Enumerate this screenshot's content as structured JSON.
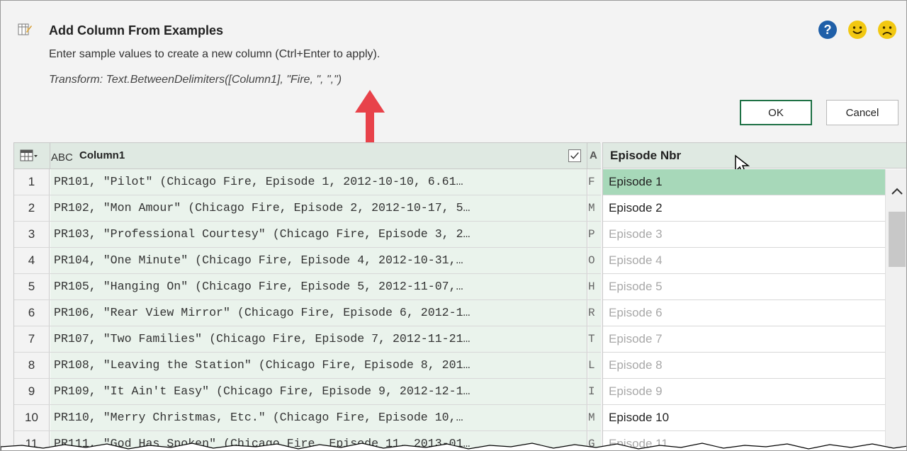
{
  "dialog": {
    "title": "Add Column From Examples",
    "subtitle": "Enter sample values to create a new column (Ctrl+Enter to apply).",
    "transform": "Transform: Text.BetweenDelimiters([Column1], \"Fire, \", \",\")",
    "ok_label": "OK",
    "cancel_label": "Cancel",
    "icons": [
      "help-icon",
      "smile-feedback-icon",
      "frown-feedback-icon"
    ]
  },
  "grid": {
    "column_type": "ABC",
    "column_header": "Column1",
    "column2_header_truncated": "A",
    "rows": [
      {
        "n": "1",
        "text": "PR101, \"Pilot\" (Chicago Fire, Episode 1, 2012-10-10, 6.61…",
        "next": "F"
      },
      {
        "n": "2",
        "text": "PR102, \"Mon Amour\" (Chicago Fire, Episode 2, 2012-10-17, 5…",
        "next": "M"
      },
      {
        "n": "3",
        "text": "PR103, \"Professional Courtesy\" (Chicago Fire, Episode 3, 2…",
        "next": "P"
      },
      {
        "n": "4",
        "text": "PR104, \"One Minute\" (Chicago Fire, Episode 4, 2012-10-31,…",
        "next": "O"
      },
      {
        "n": "5",
        "text": "PR105, \"Hanging On\" (Chicago Fire, Episode 5, 2012-11-07,…",
        "next": "H"
      },
      {
        "n": "6",
        "text": "PR106, \"Rear View Mirror\" (Chicago Fire, Episode 6, 2012-1…",
        "next": "R"
      },
      {
        "n": "7",
        "text": "PR107, \"Two Families\" (Chicago Fire, Episode 7, 2012-11-21…",
        "next": "T"
      },
      {
        "n": "8",
        "text": "PR108, \"Leaving the Station\" (Chicago Fire, Episode 8, 201…",
        "next": "L"
      },
      {
        "n": "9",
        "text": "PR109, \"It Ain't Easy\" (Chicago Fire, Episode 9, 2012-12-1…",
        "next": "I"
      },
      {
        "n": "10",
        "text": "PR110, \"Merry Christmas, Etc.\" (Chicago Fire, Episode 10,…",
        "next": "M"
      },
      {
        "n": "11",
        "text": "PR111, \"God Has Spoken\" (Chicago Fire, Episode 11, 2013-01…",
        "next": "G"
      }
    ]
  },
  "examples": {
    "header": "Episode Nbr",
    "rows": [
      {
        "text": "Episode 1",
        "state": "selected"
      },
      {
        "text": "Episode 2",
        "state": "entered"
      },
      {
        "text": "Episode 3",
        "state": "suggested"
      },
      {
        "text": "Episode 4",
        "state": "suggested"
      },
      {
        "text": "Episode 5",
        "state": "suggested"
      },
      {
        "text": "Episode 6",
        "state": "suggested"
      },
      {
        "text": "Episode 7",
        "state": "suggested"
      },
      {
        "text": "Episode 8",
        "state": "suggested"
      },
      {
        "text": "Episode 9",
        "state": "suggested"
      },
      {
        "text": "Episode 10",
        "state": "entered"
      },
      {
        "text": "Episode 11",
        "state": "suggested"
      }
    ]
  },
  "colors": {
    "header_bg": "#dfe9e2",
    "cell_bg": "#eaf3ec",
    "selected_bg": "#a7d8b9",
    "arrow": "#e8424a",
    "ok_border": "#1e7145"
  }
}
